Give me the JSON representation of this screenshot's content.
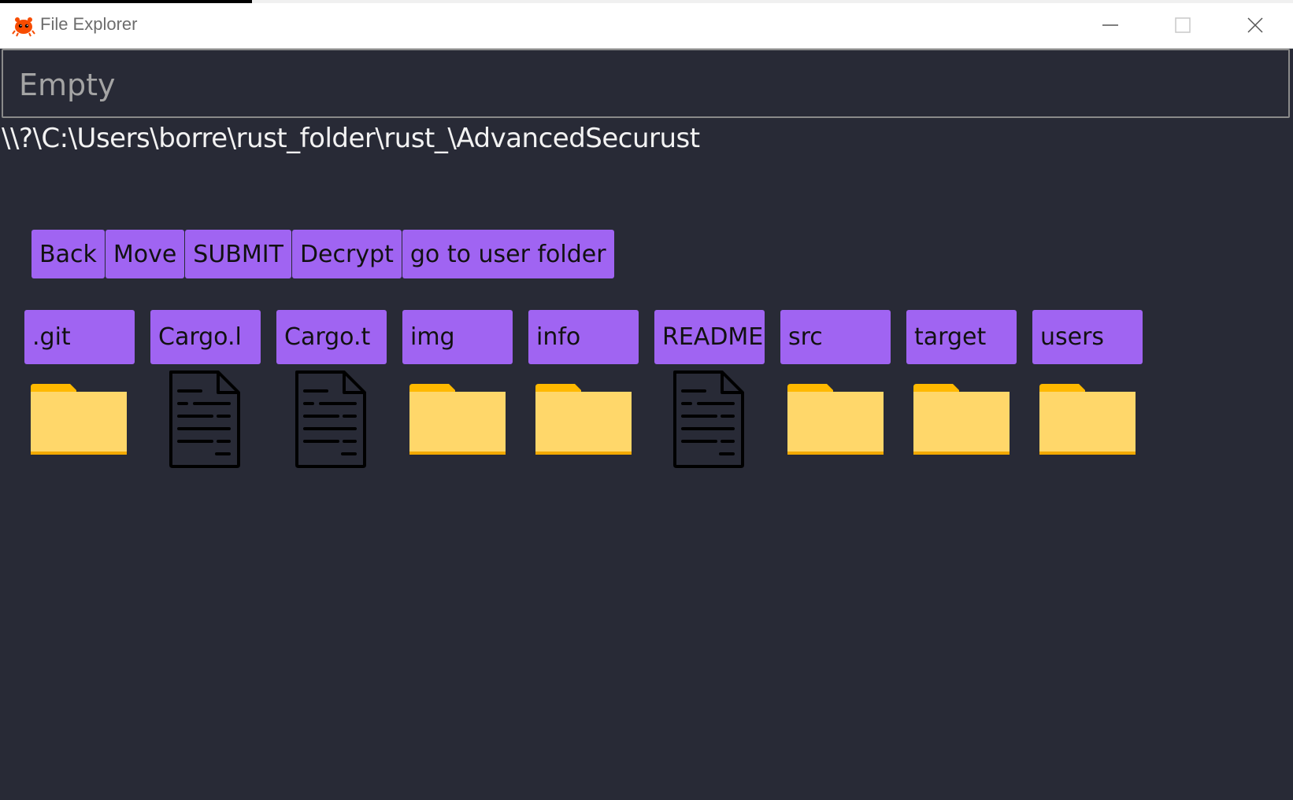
{
  "window": {
    "title": "File Explorer",
    "icon": "ferris-crab-icon",
    "controls": [
      "minimize-icon",
      "maximize-icon",
      "close-icon"
    ]
  },
  "input": {
    "value": "",
    "placeholder": "Empty"
  },
  "current_path": "\\\\?\\C:\\Users\\borre\\rust_folder\\rust_\\AdvancedSecurust",
  "toolbar": {
    "back_label": "Back",
    "move_label": "Move",
    "submit_label": "SUBMIT",
    "decrypt_label": "Decrypt",
    "user_folder_label": "go to user folder"
  },
  "items": [
    {
      "label": ".git",
      "type": "folder"
    },
    {
      "label": "Cargo.l",
      "type": "file"
    },
    {
      "label": "Cargo.t",
      "type": "file"
    },
    {
      "label": "img",
      "type": "folder"
    },
    {
      "label": "info",
      "type": "folder"
    },
    {
      "label": "README.",
      "type": "file"
    },
    {
      "label": "src",
      "type": "folder"
    },
    {
      "label": "target",
      "type": "folder"
    },
    {
      "label": "users",
      "type": "folder"
    }
  ],
  "colors": {
    "background": "#282a36",
    "accent": "#a064f2",
    "folder": "#ffd76a",
    "folder_tab": "#ffb900"
  }
}
